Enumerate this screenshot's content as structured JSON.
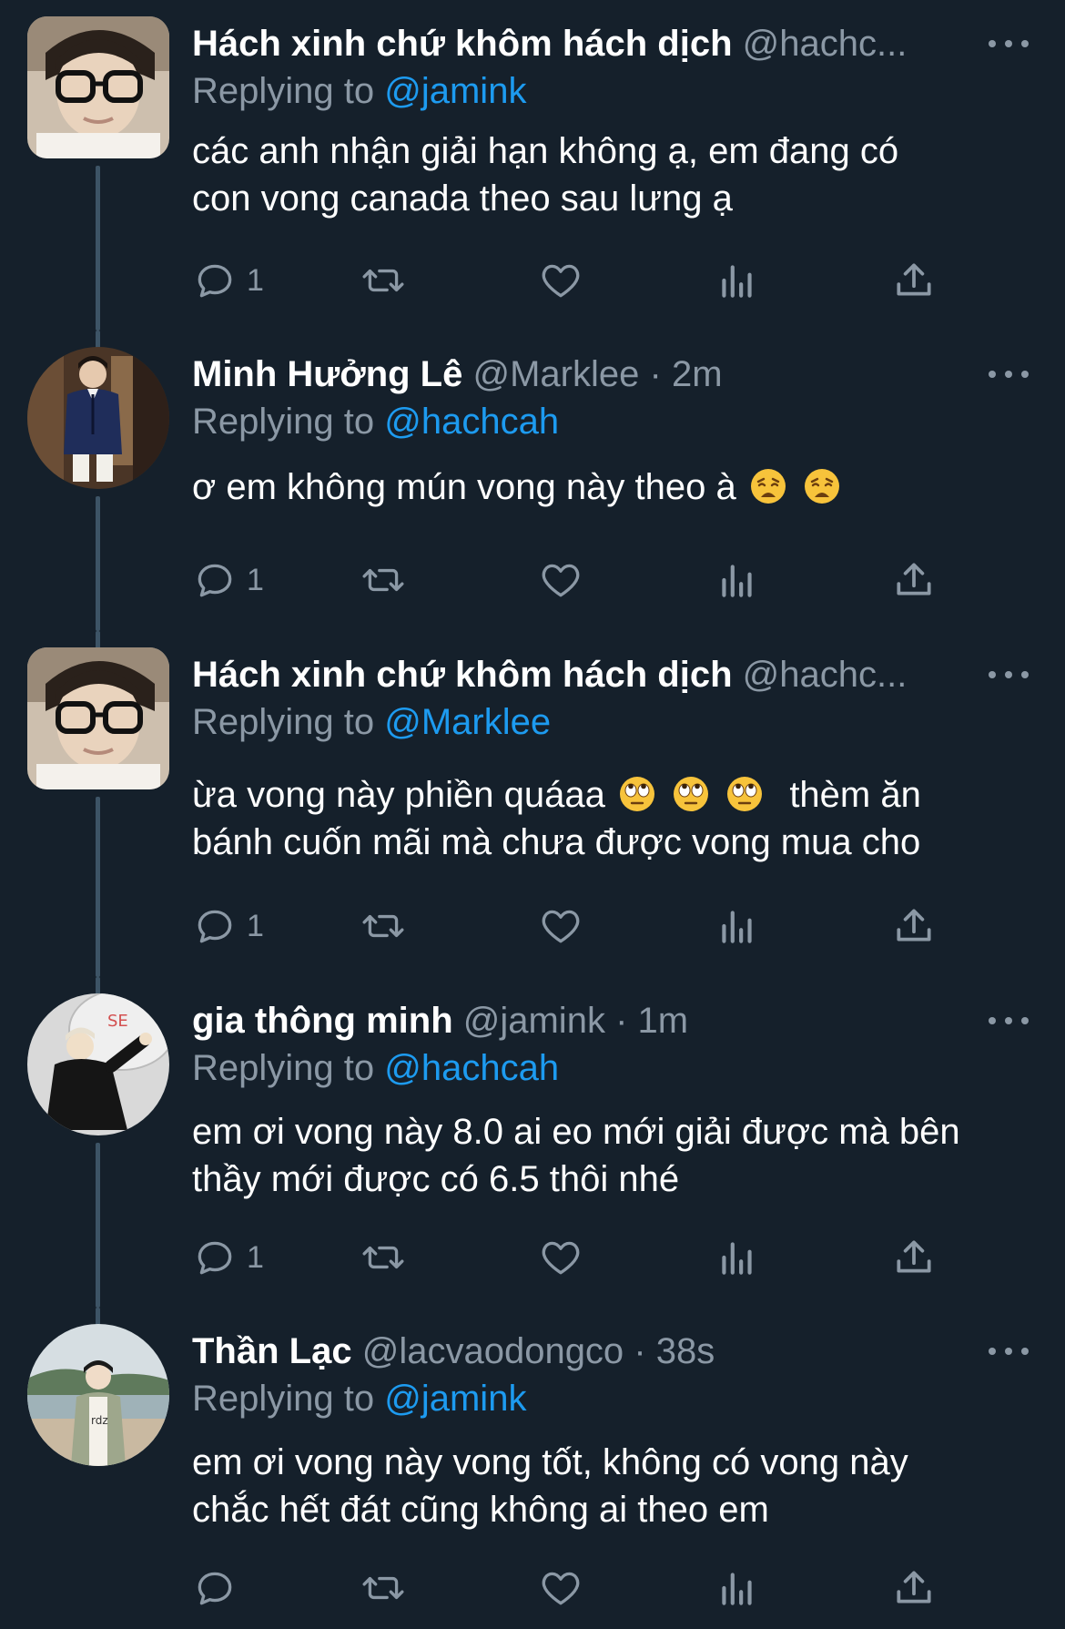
{
  "colors": {
    "background": "#15202b",
    "text": "#ffffff",
    "muted": "#8b98a5",
    "link": "#1d9bf0",
    "thread_line": "#3d5466"
  },
  "tweets": [
    {
      "name": "Hách xinh chứ khôm hách dịch",
      "handle": "@hachc...",
      "dot": "",
      "time": "",
      "replying_label": "Replying to",
      "replying_to": "@jamink",
      "text_lines": [
        "các anh nhận giải hạn không ạ, em đang có",
        "con vong canada theo sau lưng ạ"
      ],
      "reply_count": "1",
      "avatar_icon": "glasses-person-avatar"
    },
    {
      "name": "Minh Hưởng Lê",
      "handle": "@Marklee",
      "dot": "·",
      "time": "2m",
      "replying_label": "Replying to",
      "replying_to": "@hachcah",
      "text": "ơ em không mún vong này theo à",
      "emojis": [
        "weary-face",
        "weary-face"
      ],
      "reply_count": "1",
      "avatar_icon": "suit-person-avatar"
    },
    {
      "name": "Hách xinh chứ khôm hách dịch",
      "handle": "@hachc...",
      "dot": "",
      "time": "",
      "replying_label": "Replying to",
      "replying_to": "@Marklee",
      "text_lines": [
        "ừa vong này phiền quáaa",
        "bánh cuốn mãi mà chưa được vong mua cho"
      ],
      "text_after_emojis": "thèm ăn",
      "emojis": [
        "eye-roll-face",
        "eye-roll-face",
        "eye-roll-face"
      ],
      "reply_count": "1",
      "avatar_icon": "glasses-person-avatar"
    },
    {
      "name": "gia thông minh",
      "handle": "@jamink",
      "dot": "·",
      "time": "1m",
      "replying_label": "Replying to",
      "replying_to": "@hachcah",
      "text_lines": [
        "em ơi vong này 8.0 ai eo mới giải được mà bên",
        "thầy mới được có 6.5 thôi nhé"
      ],
      "reply_count": "1",
      "avatar_icon": "black-jacket-person-avatar"
    },
    {
      "name": "Thần Lạc",
      "handle": "@lacvaodongco",
      "dot": "·",
      "time": "38s",
      "replying_label": "Replying to",
      "replying_to": "@jamink",
      "text_lines": [
        "em ơi vong này vong tốt, không có vong này",
        "chắc hết đát cũng không ai theo em"
      ],
      "reply_count": "",
      "avatar_icon": "beach-person-avatar"
    }
  ]
}
